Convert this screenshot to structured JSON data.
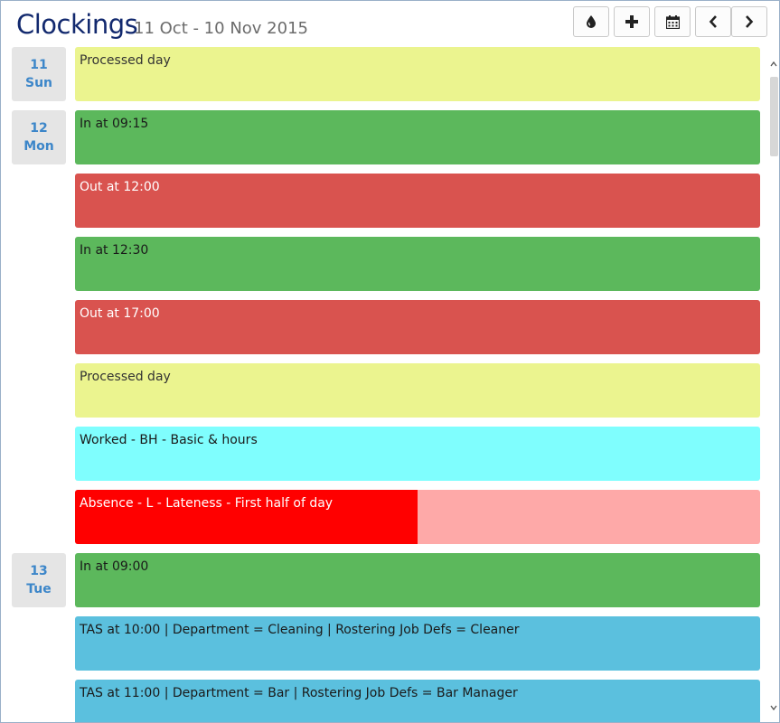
{
  "header": {
    "title": "Clockings",
    "date_range": "11 Oct - 10 Nov 2015"
  },
  "toolbar": {
    "buttons": [
      {
        "icon": "drop-icon"
      },
      {
        "icon": "plus-icon"
      },
      {
        "icon": "calendar-icon"
      },
      {
        "icon": "chevron-left-icon"
      },
      {
        "icon": "chevron-right-icon"
      }
    ]
  },
  "days": [
    {
      "day": "11",
      "weekday": "Sun"
    },
    {
      "day": "12",
      "weekday": "Mon"
    },
    {
      "day": "13",
      "weekday": "Tue"
    }
  ],
  "entries": [
    {
      "label": "Processed day",
      "color": "#ebf48f",
      "text_color": "#333333"
    },
    {
      "label": "In at 09:15",
      "color": "#5cb85c",
      "text_color": "#1a1a1a"
    },
    {
      "label": "Out at 12:00",
      "color": "#d9534f",
      "text_color": "#ffffff"
    },
    {
      "label": "In at 12:30",
      "color": "#5cb85c",
      "text_color": "#1a1a1a"
    },
    {
      "label": "Out at 17:00",
      "color": "#d9534f",
      "text_color": "#ffffff"
    },
    {
      "label": "Processed day",
      "color": "#ebf48f",
      "text_color": "#333333"
    },
    {
      "label": "Worked - BH - Basic & hours",
      "color": "#7ffefe",
      "text_color": "#1a1a1a"
    },
    {
      "label": "Absence - L - Lateness - First half of day",
      "color": "#fea9a8",
      "accent": "#ff0000",
      "text_color": "#ffffff"
    },
    {
      "label": "In at 09:00",
      "color": "#5cb85c",
      "text_color": "#1a1a1a"
    },
    {
      "label": "TAS at 10:00 | Department = Cleaning | Rostering Job Defs = Cleaner",
      "color": "#5bc0de",
      "text_color": "#1a1a1a"
    },
    {
      "label": "TAS at 11:00 | Department = Bar | Rostering Job Defs = Bar Manager",
      "color": "#5bc0de",
      "text_color": "#1a1a1a"
    }
  ]
}
